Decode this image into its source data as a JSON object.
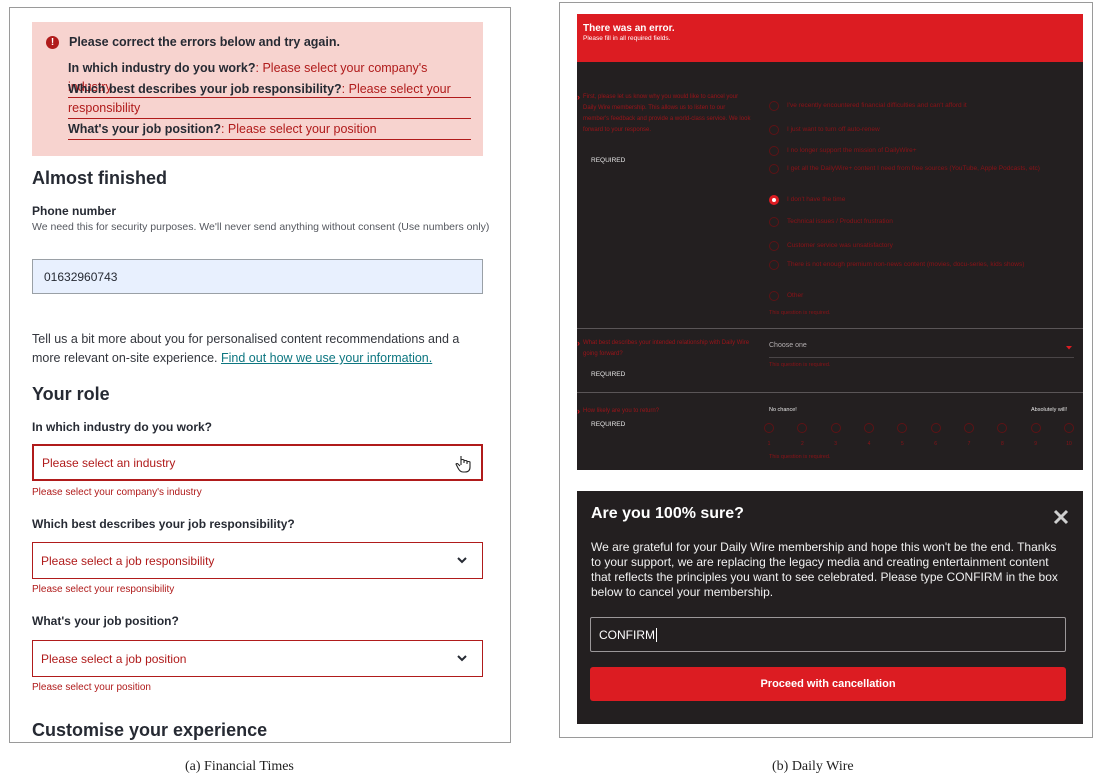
{
  "ft": {
    "caption": "(a) Financial Times",
    "error_summary": {
      "title": "Please correct the errors below and try again.",
      "items": [
        {
          "question": "In which industry do you work?",
          "message": ": Please select your company's industry"
        },
        {
          "question": "Which best describes your job responsibility?",
          "message": ": Please select your responsibility"
        },
        {
          "question": "What's your job position?",
          "message": ": Please select your position"
        }
      ]
    },
    "heading_finished": "Almost finished",
    "phone": {
      "label": "Phone number",
      "hint": "We need this for security purposes. We'll never send anything without consent (Use numbers only)",
      "value": "01632960743"
    },
    "intro_text": "Tell us a bit more about you for personalised content recommendations and a more relevant on-site experience.",
    "intro_link": "Find out how we use your information.",
    "heading_role": "Your role",
    "industry": {
      "label": "In which industry do you work?",
      "placeholder": "Please select an industry",
      "error": "Please select your company's industry"
    },
    "responsibility": {
      "label": "Which best describes your job responsibility?",
      "placeholder": "Please select a job responsibility",
      "error": "Please select your responsibility"
    },
    "position": {
      "label": "What's your job position?",
      "placeholder": "Please select a job position",
      "error": "Please select your position"
    },
    "heading_customise": "Customise your experience"
  },
  "dw": {
    "caption": "(b) Daily Wire",
    "banner": {
      "title": "There was an error.",
      "subtitle": "Please fill in all required fields."
    },
    "q1": {
      "text": "First, please let us know why you would like to cancel your Daily Wire membership. This allows us to listen to our member's feedback and provide a world-class service. We look forward to your response.",
      "required": "REQUIRED",
      "options": [
        {
          "label": "I've recently encountered financial difficulties and can't afford it",
          "selected": false
        },
        {
          "label": "I just want to turn off auto-renew",
          "selected": false
        },
        {
          "label": "I no longer support the mission of DailyWire+",
          "selected": false
        },
        {
          "label": "I get all the DailyWire+ content I need from free sources (YouTube, Apple Podcasts, etc)",
          "selected": false
        },
        {
          "label": "I don't have the time",
          "selected": true
        },
        {
          "label": "Technical issues / Product frustration",
          "selected": false
        },
        {
          "label": "Customer service was unsatisfactory",
          "selected": false
        },
        {
          "label": "There is not enough premium non-news content (movies, docu-series, kids shows)",
          "selected": false
        },
        {
          "label": "Other",
          "selected": false
        }
      ],
      "note": "This question is required."
    },
    "q2": {
      "text": "What best describes your intended relationship with Daily Wire going forward?",
      "required": "REQUIRED",
      "select_value": "Choose one",
      "note": "This question is required."
    },
    "q3": {
      "text": "How likely are you to return?",
      "required": "REQUIRED",
      "low_label": "No chance!",
      "high_label": "Absolutely will!",
      "scale": [
        "1",
        "2",
        "3",
        "4",
        "5",
        "6",
        "7",
        "8",
        "9",
        "10"
      ],
      "note": "This question is required."
    },
    "modal": {
      "title": "Are you 100% sure?",
      "body": "We are grateful for your Daily Wire membership and hope this won't be the end. Thanks to your support, we are replacing the legacy media and creating entertainment content that reflects the principles you want to see celebrated. Please type CONFIRM in the box below to cancel your membership.",
      "input_value": "CONFIRM",
      "proceed_label": "Proceed with cancellation"
    }
  },
  "colors": {
    "ft_error": "#b01b1b",
    "ft_error_bg": "#f7d3cf",
    "dw_red": "#dc1c22",
    "dw_dark": "#231f20"
  }
}
